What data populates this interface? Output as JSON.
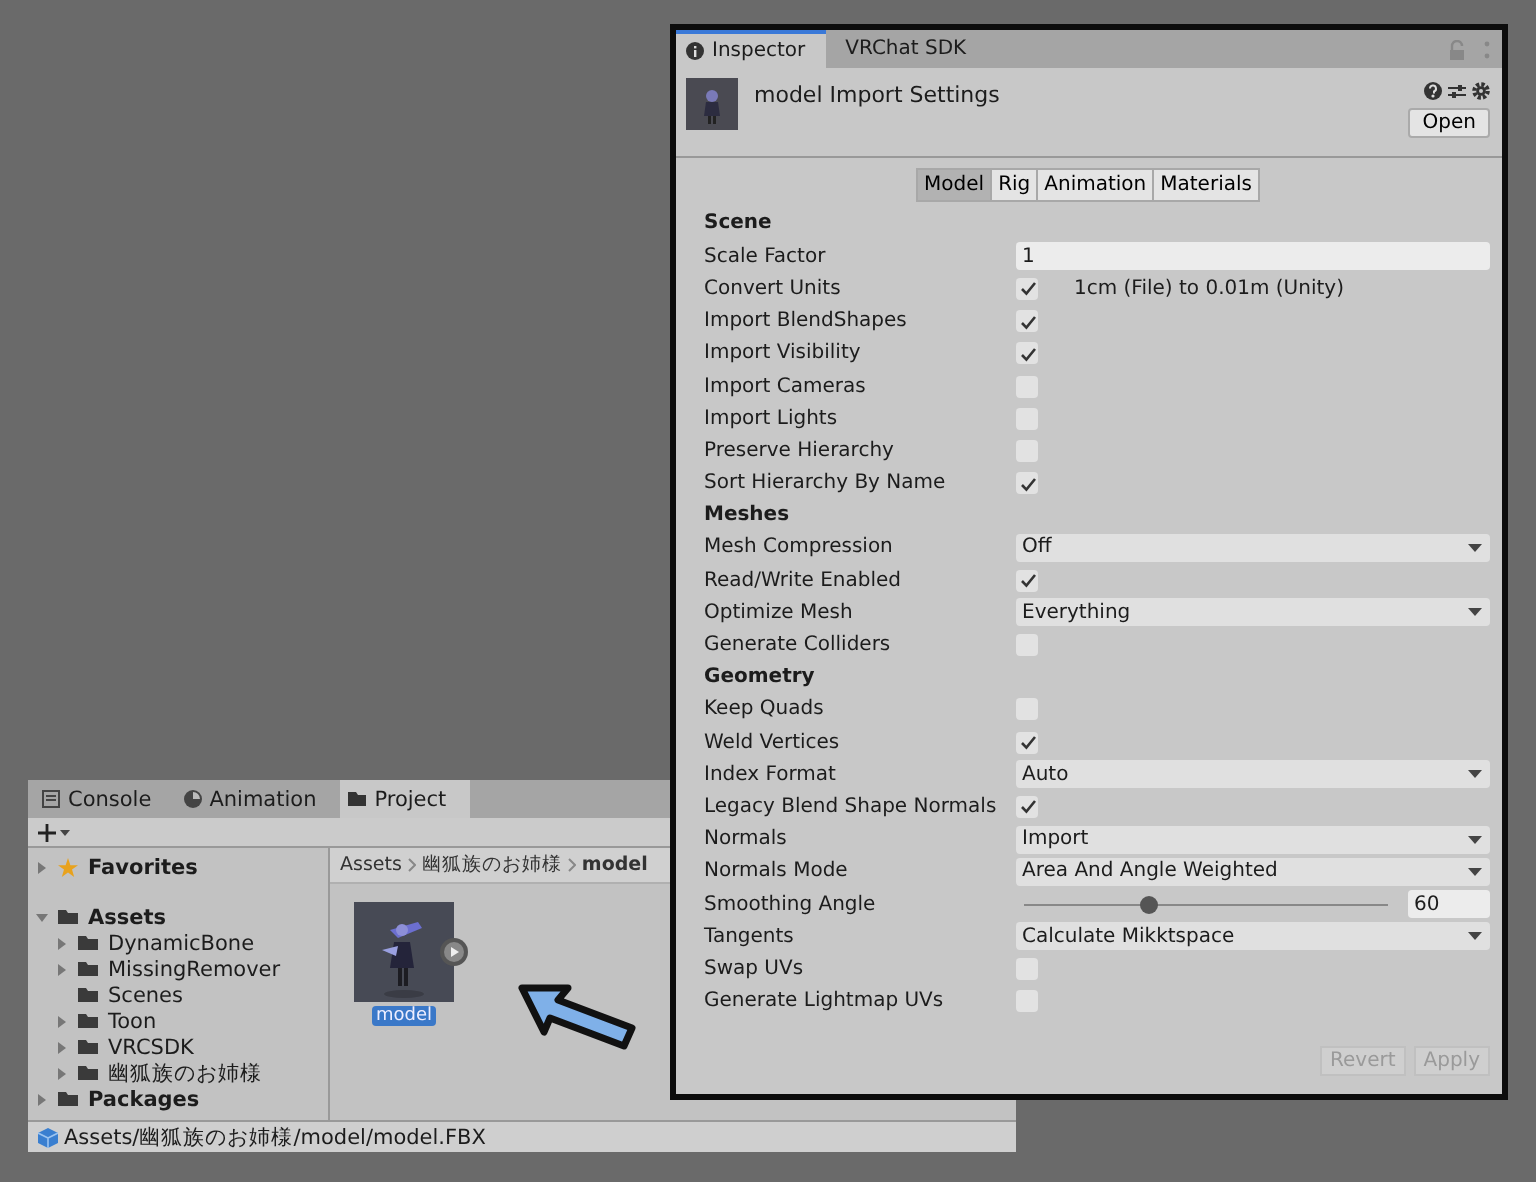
{
  "inspector": {
    "tabs": [
      {
        "label": "Inspector",
        "selected": true
      },
      {
        "label": "VRChat SDK",
        "selected": false
      }
    ],
    "header": {
      "title": "model Import Settings",
      "open_button": "Open"
    },
    "model_tabs": [
      {
        "label": "Model",
        "selected": true
      },
      {
        "label": "Rig",
        "selected": false
      },
      {
        "label": "Animation",
        "selected": false
      },
      {
        "label": "Materials",
        "selected": false
      }
    ],
    "settings": [
      {
        "kind": "heading",
        "label": "Scene"
      },
      {
        "kind": "text",
        "label": "Scale Factor",
        "value": "1"
      },
      {
        "kind": "checkbox",
        "label": "Convert Units",
        "checked": true,
        "note": "1cm (File) to 0.01m (Unity)"
      },
      {
        "kind": "checkbox",
        "label": "Import BlendShapes",
        "checked": true
      },
      {
        "kind": "checkbox",
        "label": "Import Visibility",
        "checked": true
      },
      {
        "kind": "checkbox",
        "label": "Import Cameras",
        "checked": false
      },
      {
        "kind": "checkbox",
        "label": "Import Lights",
        "checked": false
      },
      {
        "kind": "checkbox",
        "label": "Preserve Hierarchy",
        "checked": false
      },
      {
        "kind": "checkbox",
        "label": "Sort Hierarchy By Name",
        "checked": true
      },
      {
        "kind": "heading",
        "label": "Meshes"
      },
      {
        "kind": "dropdown",
        "label": "Mesh Compression",
        "value": "Off"
      },
      {
        "kind": "checkbox",
        "label": "Read/Write Enabled",
        "checked": true
      },
      {
        "kind": "dropdown",
        "label": "Optimize Mesh",
        "value": "Everything"
      },
      {
        "kind": "checkbox",
        "label": "Generate Colliders",
        "checked": false
      },
      {
        "kind": "heading",
        "label": "Geometry"
      },
      {
        "kind": "checkbox",
        "label": "Keep Quads",
        "checked": false
      },
      {
        "kind": "checkbox",
        "label": "Weld Vertices",
        "checked": true
      },
      {
        "kind": "dropdown",
        "label": "Index Format",
        "value": "Auto"
      },
      {
        "kind": "checkbox",
        "label": "Legacy Blend Shape Normals",
        "checked": true
      },
      {
        "kind": "dropdown",
        "label": "Normals",
        "value": "Import"
      },
      {
        "kind": "dropdown",
        "label": "Normals Mode",
        "value": "Area And Angle Weighted"
      },
      {
        "kind": "slider",
        "label": "Smoothing Angle",
        "level": 0.34,
        "value": "60"
      },
      {
        "kind": "dropdown",
        "label": "Tangents",
        "value": "Calculate Mikktspace"
      },
      {
        "kind": "checkbox",
        "label": "Swap UVs",
        "checked": false
      },
      {
        "kind": "checkbox",
        "label": "Generate Lightmap UVs",
        "checked": false
      }
    ],
    "buttons": [
      {
        "label": "Revert",
        "disabled": true
      },
      {
        "label": "Apply",
        "disabled": true
      }
    ]
  },
  "project": {
    "tabs": [
      {
        "label": "Console",
        "selected": false
      },
      {
        "label": "Animation",
        "selected": false
      },
      {
        "label": "Project",
        "selected": true
      }
    ],
    "tree": [
      {
        "kind": "favorites",
        "label": "Favorites",
        "expanded": false
      },
      {
        "kind": "folder",
        "label": "Assets",
        "expanded": true,
        "children": [
          {
            "kind": "folder",
            "label": "DynamicBone",
            "expanded": false
          },
          {
            "kind": "folder",
            "label": "MissingRemover",
            "expanded": false
          },
          {
            "kind": "folder",
            "label": "Scenes"
          },
          {
            "kind": "folder",
            "label": "Toon",
            "expanded": false
          },
          {
            "kind": "folder",
            "label": "VRCSDK",
            "expanded": false
          },
          {
            "kind": "folder",
            "label": "幽狐族のお姉様",
            "expanded": false
          }
        ]
      },
      {
        "kind": "folder",
        "label": "Packages",
        "expanded": false
      }
    ],
    "breadcrumb": [
      "Assets",
      "幽狐族のお姉様",
      "model"
    ],
    "assets": [
      {
        "label": "model",
        "selected": true
      }
    ],
    "path": "Assets/幽狐族のお姉様/model/model.FBX"
  }
}
